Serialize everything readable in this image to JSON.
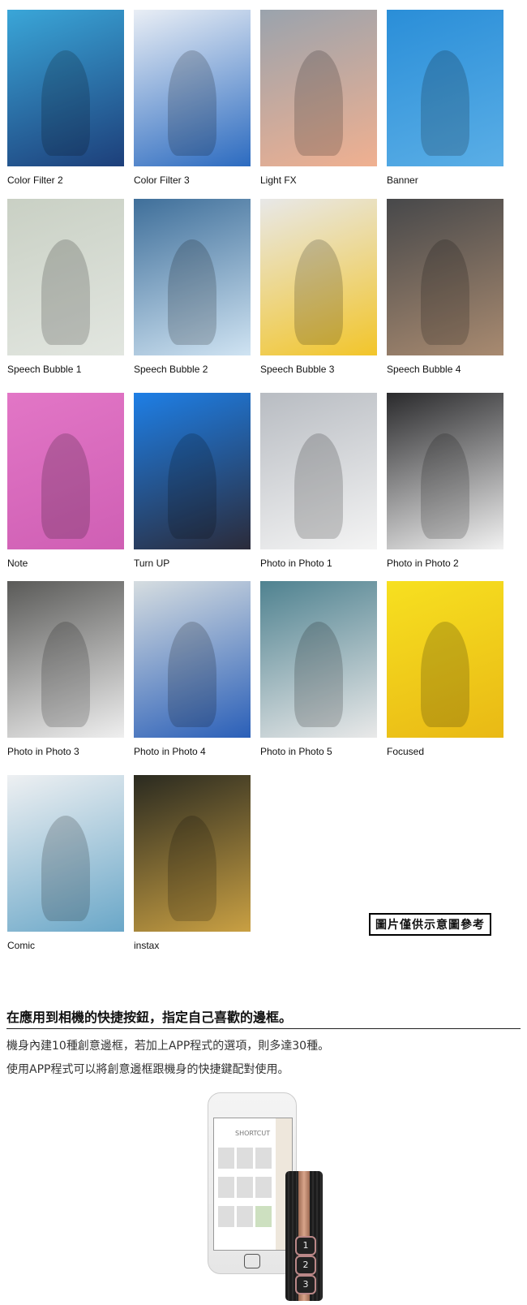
{
  "frames": [
    {
      "label": "Color Filter 2",
      "colors": [
        "#3aa6d8",
        "#1d3f7a"
      ]
    },
    {
      "label": "Color Filter 3",
      "colors": [
        "#e9eef5",
        "#2c6bc0"
      ]
    },
    {
      "label": "Light FX",
      "colors": [
        "#9aa3ad",
        "#f0b090"
      ]
    },
    {
      "label": "Banner",
      "colors": [
        "#2a8ed8",
        "#5aaee6"
      ]
    },
    {
      "label": "Speech Bubble 1",
      "colors": [
        "#c9d0c4",
        "#e2e6e0"
      ]
    },
    {
      "label": "Speech Bubble 2",
      "colors": [
        "#3f6f9a",
        "#cfe3f2"
      ]
    },
    {
      "label": "Speech Bubble 3",
      "colors": [
        "#e8e8e8",
        "#f2c52a"
      ]
    },
    {
      "label": "Speech Bubble 4",
      "colors": [
        "#47484a",
        "#a88a70"
      ]
    },
    {
      "label": "Note",
      "colors": [
        "#e276c6",
        "#cf5fb4"
      ]
    },
    {
      "label": "Turn UP",
      "colors": [
        "#1e7fe6",
        "#2b2b3a"
      ]
    },
    {
      "label": "Photo in Photo 1",
      "colors": [
        "#b8bcc2",
        "#f4f4f4"
      ]
    },
    {
      "label": "Photo in Photo 2",
      "colors": [
        "#2a2a2c",
        "#f2f2f2"
      ]
    },
    {
      "label": "Photo in Photo 3",
      "colors": [
        "#5a5a58",
        "#efefef"
      ]
    },
    {
      "label": "Photo in Photo 4",
      "colors": [
        "#d6dde0",
        "#2a5fb8"
      ]
    },
    {
      "label": "Photo in Photo 5",
      "colors": [
        "#4f8290",
        "#e9e9e9"
      ]
    },
    {
      "label": "Focused",
      "colors": [
        "#f7e020",
        "#e9b915"
      ]
    },
    {
      "label": "Comic",
      "colors": [
        "#eef0f2",
        "#6aa7c8"
      ]
    },
    {
      "label": "instax",
      "colors": [
        "#2a2a20",
        "#c9a043"
      ]
    }
  ],
  "disclaimer": "圖片僅供示意圖參考",
  "heading": "在應用到相機的快捷按鈕，指定自己喜歡的邊框。",
  "paragraphs": [
    "機身內建10種創意邊框，若加上APP程式的選項，則多達30種。",
    "使用APP程式可以將創意邊框跟機身的快捷鍵配對使用。"
  ],
  "phone_screen": {
    "title": "SHORTCUT"
  },
  "camera_buttons": [
    "1",
    "2",
    "3"
  ]
}
